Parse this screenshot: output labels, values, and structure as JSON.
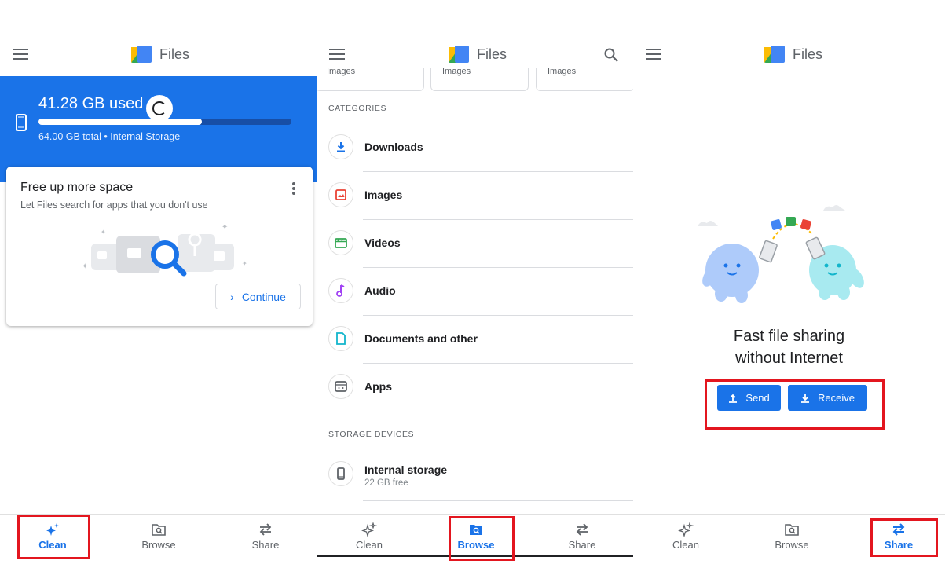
{
  "app": {
    "title": "Files"
  },
  "storage": {
    "used_label": "41.28 GB used",
    "total_label": "64.00 GB total • Internal Storage",
    "used_fraction": 0.645
  },
  "clean_card": {
    "title": "Free up more space",
    "subtitle": "Let Files search for apps that you don't use",
    "continue_label": "Continue"
  },
  "browse": {
    "chips": [
      "Images",
      "Images",
      "Images"
    ],
    "categories_header": "CATEGORIES",
    "categories": [
      {
        "label": "Downloads",
        "icon": "download-icon",
        "color": "#1a73e8"
      },
      {
        "label": "Images",
        "icon": "image-icon",
        "color": "#ea4335"
      },
      {
        "label": "Videos",
        "icon": "video-icon",
        "color": "#34a853"
      },
      {
        "label": "Audio",
        "icon": "audio-icon",
        "color": "#a142f4"
      },
      {
        "label": "Documents and other",
        "icon": "document-icon",
        "color": "#12b5cb"
      },
      {
        "label": "Apps",
        "icon": "apps-icon",
        "color": "#5f6368"
      }
    ],
    "storage_header": "STORAGE DEVICES",
    "internal_storage": {
      "label": "Internal storage",
      "sub": "22 GB free"
    }
  },
  "share": {
    "headline_line1": "Fast file sharing",
    "headline_line2": "without Internet",
    "send_label": "Send",
    "receive_label": "Receive"
  },
  "nav": {
    "clean": "Clean",
    "browse": "Browse",
    "share": "Share"
  },
  "colors": {
    "accent": "#1a73e8",
    "highlight": "#e3161f"
  }
}
